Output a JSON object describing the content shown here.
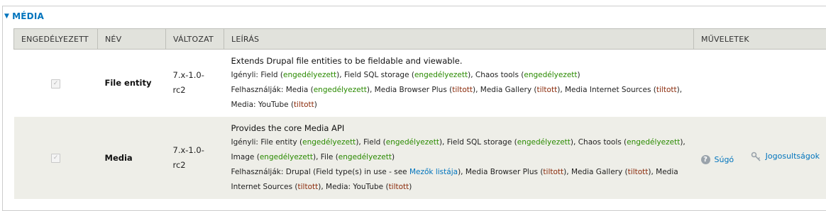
{
  "section": {
    "title": "MÉDIA",
    "toggle_icon": "triangle-down-icon"
  },
  "columns": {
    "enabled": "ENGEDÉLYEZETT",
    "name": "NÉV",
    "version": "VÁLTOZAT",
    "description": "LEÍRÁS",
    "operations": "MŰVELETEK"
  },
  "colors": {
    "link": "#0074bd",
    "enabled_status": "#2a8a00",
    "disabled_status": "#8a2a0a",
    "header_bg": "#e1e2dc",
    "even_row_bg": "#eeeee8"
  },
  "modules": [
    {
      "enabled": true,
      "name": "File entity",
      "version_line1": "7.x-1.0-",
      "version_line2": "rc2",
      "description": "Extends Drupal file entities to be fieldable and viewable.",
      "requires_label": "Igényli:",
      "requires": [
        {
          "name": "Field",
          "status": "engedélyezett"
        },
        {
          "name": "Field SQL storage",
          "status": "engedélyezett"
        },
        {
          "name": "Chaos tools",
          "status": "engedélyezett"
        }
      ],
      "required_by_label": "Felhasználják:",
      "required_by": [
        {
          "name": "Media",
          "status": "engedélyezett"
        },
        {
          "name": "Media Browser Plus",
          "status": "tiltott"
        },
        {
          "name": "Media Gallery",
          "status": "tiltott"
        },
        {
          "name": "Media Internet Sources",
          "status": "tiltott"
        },
        {
          "name": "Media: YouTube",
          "status": "tiltott"
        }
      ]
    },
    {
      "enabled": true,
      "name": "Media",
      "version_line1": "7.x-1.0-",
      "version_line2": "rc2",
      "description": "Provides the core Media API",
      "requires_label": "Igényli:",
      "requires": [
        {
          "name": "File entity",
          "status": "engedélyezett"
        },
        {
          "name": "Field",
          "status": "engedélyezett"
        },
        {
          "name": "Field SQL storage",
          "status": "engedélyezett"
        },
        {
          "name": "Chaos tools",
          "status": "engedélyezett"
        },
        {
          "name": "Image",
          "status": "engedélyezett"
        },
        {
          "name": "File",
          "status": "engedélyezett"
        }
      ],
      "required_by_label": "Felhasználják:",
      "required_by_drupal_prefix": "Drupal (Field type(s) in use - see",
      "required_by_drupal_link": "Mezők listája",
      "required_by": [
        {
          "name": "Media Browser Plus",
          "status": "tiltott"
        },
        {
          "name": "Media Gallery",
          "status": "tiltott"
        },
        {
          "name": "Media Internet Sources",
          "status": "tiltott"
        },
        {
          "name": "Media: YouTube",
          "status": "tiltott"
        }
      ],
      "operations": {
        "help_label": "Súgó",
        "help_icon": "help-circle-icon",
        "permissions_label": "Jogosultságok",
        "permissions_icon": "key-icon"
      }
    }
  ]
}
